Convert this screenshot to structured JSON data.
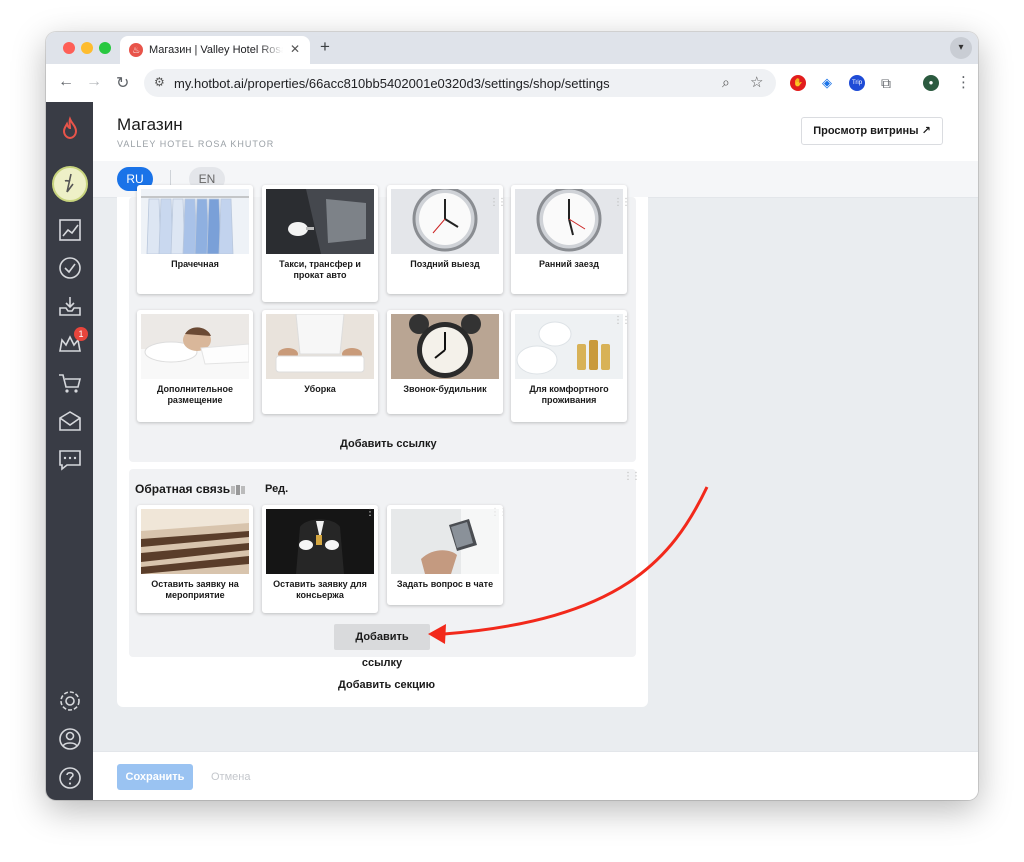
{
  "browser": {
    "tab_title": "Магазин | Valley Hotel Rosa Khutor",
    "tab_close": "✕",
    "new_tab": "+",
    "url": "my.hotbot.ai/properties/66acc810bb5402001e0320d3/settings/shop/settings"
  },
  "header": {
    "title": "Магазин",
    "subtitle": "VALLEY HOTEL ROSA KHUTOR",
    "preview_button": "Просмотр витрины ↗"
  },
  "languages": {
    "ru": "RU",
    "en": "EN"
  },
  "sidebar": {
    "notification_badge": "1"
  },
  "section_services": {
    "cards": [
      {
        "label": "Прачечная"
      },
      {
        "label": "Такси, трансфер и прокат авто"
      },
      {
        "label": "Поздний выезд"
      },
      {
        "label": "Ранний заезд"
      },
      {
        "label": "Дополнительное размещение"
      },
      {
        "label": "Уборка"
      },
      {
        "label": "Звонок-будильник"
      },
      {
        "label": "Для комфортного проживания"
      }
    ],
    "add_link": "Добавить ссылку"
  },
  "section_feedback": {
    "title": "Обратная связь",
    "edit": "Ред.",
    "cards": [
      {
        "label": "Оставить заявку на мероприятие"
      },
      {
        "label": "Оставить заявку для консьержа"
      },
      {
        "label": "Задать вопрос в чате"
      }
    ],
    "add_link": "Добавить ссылку"
  },
  "add_section": "Добавить секцию",
  "footer": {
    "save": "Сохранить",
    "cancel": "Отмена"
  },
  "colors": {
    "accent": "#1a73e8",
    "sidebar": "#393c45",
    "annotation_arrow": "#f2291b"
  }
}
